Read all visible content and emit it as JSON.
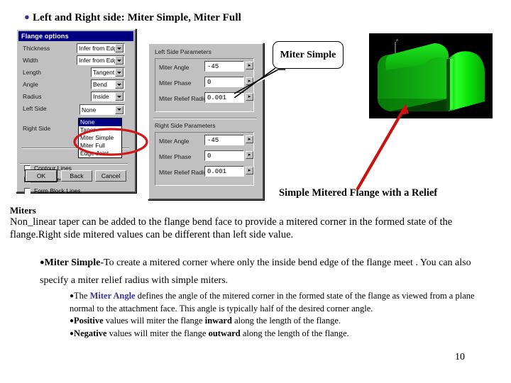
{
  "slide": {
    "title": "Left and Right side: Miter Simple, Miter Full",
    "page_number": "10",
    "accent_color": "#333399"
  },
  "flange_dialog": {
    "title": "Flange options",
    "rows": [
      {
        "label": "Thickness",
        "value": "Infer from Edge"
      },
      {
        "label": "Width",
        "value": "Infer from Edge"
      },
      {
        "label": "Length",
        "value": "Tangent"
      },
      {
        "label": "Angle",
        "value": "Bend"
      },
      {
        "label": "Radius",
        "value": "Inside"
      },
      {
        "label": "Left Side",
        "value": "None"
      },
      {
        "label": "Right Side",
        "value": "None"
      }
    ],
    "dropdown_options": [
      {
        "label": "None",
        "selected": true
      },
      {
        "label": "Taper",
        "selected": false
      },
      {
        "label": "Miter Simple",
        "selected": false
      },
      {
        "label": "Miter Full",
        "selected": false
      },
      {
        "label": "Edge Joint",
        "selected": false
      }
    ],
    "checkboxes": [
      {
        "label": "Contour Lines",
        "checked": false
      },
      {
        "label": "Mold Lines",
        "checked": false
      },
      {
        "label": "Form Block Lines",
        "checked": false
      }
    ],
    "buttons": {
      "ok": "OK",
      "back": "Back",
      "cancel": "Cancel"
    }
  },
  "params_dialog": {
    "left_group": {
      "title": "Left Side Parameters",
      "fields": [
        {
          "label": "Miter Angle",
          "value": "-45"
        },
        {
          "label": "Miter Phase",
          "value": "0"
        },
        {
          "label": "Miter Relief Radius",
          "value": "0.001"
        }
      ]
    },
    "right_group": {
      "title": "Right Side Parameters",
      "fields": [
        {
          "label": "Miter Angle",
          "value": "-45"
        },
        {
          "label": "Miter Phase",
          "value": "0"
        },
        {
          "label": "Miter Relief Radius",
          "value": "0.001"
        }
      ]
    }
  },
  "callout": {
    "label": "Miter Simple"
  },
  "model": {
    "axis_label": "x",
    "caption": "Simple Mitered Flange with a Relief",
    "background_color": "#000000",
    "body_color": "#00c000",
    "highlight_color": "#00ff00",
    "arrow_color": "#cc1111"
  },
  "body": {
    "heading": "Miters",
    "paragraph": "Non_linear taper can be added to the flange bend face to provide a mitered corner in the formed state of the flange.Right side mitered values can be different than left side value.",
    "bullet": {
      "term": "Miter Simple",
      "dash": "-",
      "text": "To create a mitered corner where only the inside bend edge of the flange meet .  You can also specify a miter relief radius with simple miters."
    },
    "sub_bullets": [
      {
        "lead": "The ",
        "accent": "Miter Angle",
        "text": " defines the angle of the mitered corner in the formed state of the flange as viewed from a plane normal to the attachment face. This angle is typically half of the desired corner angle."
      },
      {
        "lead": "",
        "bold_start": "Positive",
        "mid": " values will miter the flange ",
        "bold_mid": "inward",
        "tail": " along the length of the flange."
      },
      {
        "lead": "",
        "bold_start": "Negative",
        "mid": " values will miter the flange ",
        "bold_mid": "outward",
        "tail": " along the length of the flange."
      }
    ]
  }
}
